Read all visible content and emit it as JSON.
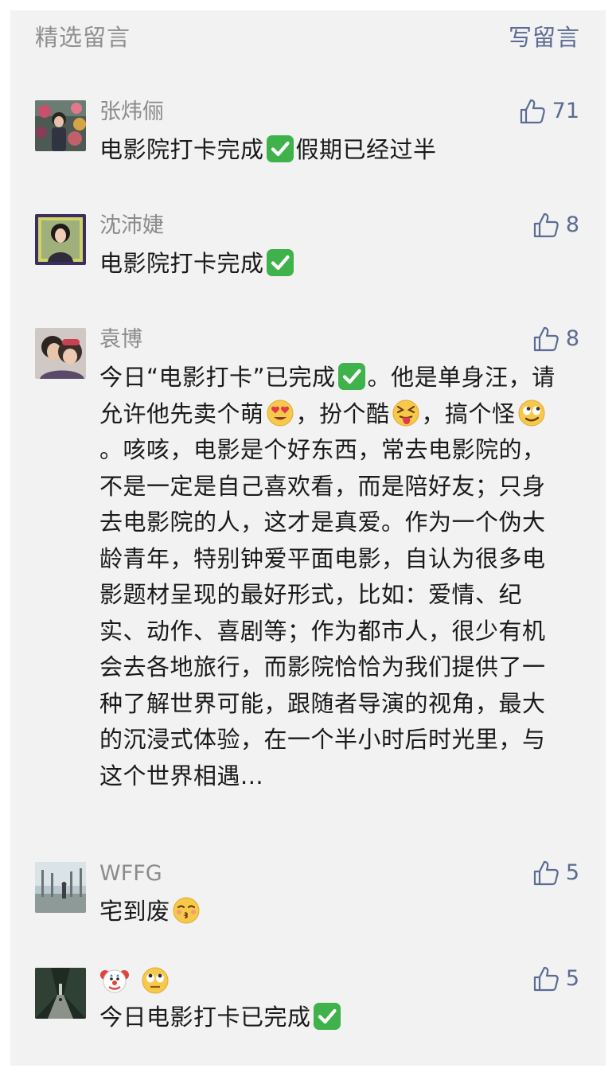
{
  "header": {
    "title": "精选留言",
    "write_label": "写留言"
  },
  "colors": {
    "background": "#f2f2f2",
    "accent": "#5b6b93",
    "muted_text": "#8b8b8b",
    "body_text": "#1a1a1a",
    "check_green": "#3fb24b"
  },
  "comments": [
    {
      "nickname": "张炜俪",
      "likes": "71",
      "segments": [
        "电影院打卡完成",
        "check-mark-icon",
        "假期已经过半"
      ]
    },
    {
      "nickname": "沈沛婕",
      "likes": "8",
      "segments": [
        "电影院打卡完成",
        "check-mark-icon"
      ]
    },
    {
      "nickname": "袁博",
      "likes": "8",
      "segments": [
        "今日“电影打卡”已完成",
        "check-mark-icon",
        "。他是单身汪，请允许他先卖个萌",
        "heart-eyes-emoji",
        "，扮个酷",
        "tongue-out-emoji",
        "，搞个怪",
        "rolling-eyes-smile-emoji",
        "。咳咳，电影是个好东西，常去电影院的，不是一定是自己喜欢看，而是陪好友；只身去电影院的人，这才是真爱。作为一个伪大龄青年，特别钟爱平面电影，自认为很多电影题材呈现的最好形式，比如：爱情、纪实、动作、喜剧等；作为都市人，很少有机会去各地旅行，而影院恰恰为我们提供了一种了解世界可能，跟随者导演的视角，最大的沉浸式体验，在一个半小时后时光里，与这个世界相遇..."
      ]
    },
    {
      "nickname": "WFFG",
      "likes": "5",
      "segments": [
        "宅到废",
        "kissing-emoji"
      ]
    },
    {
      "nickname_icons": [
        "clown-face-emoji",
        "eye-roll-emoji"
      ],
      "likes": "5",
      "segments": [
        "今日电影打卡已完成",
        "check-mark-icon"
      ]
    }
  ]
}
